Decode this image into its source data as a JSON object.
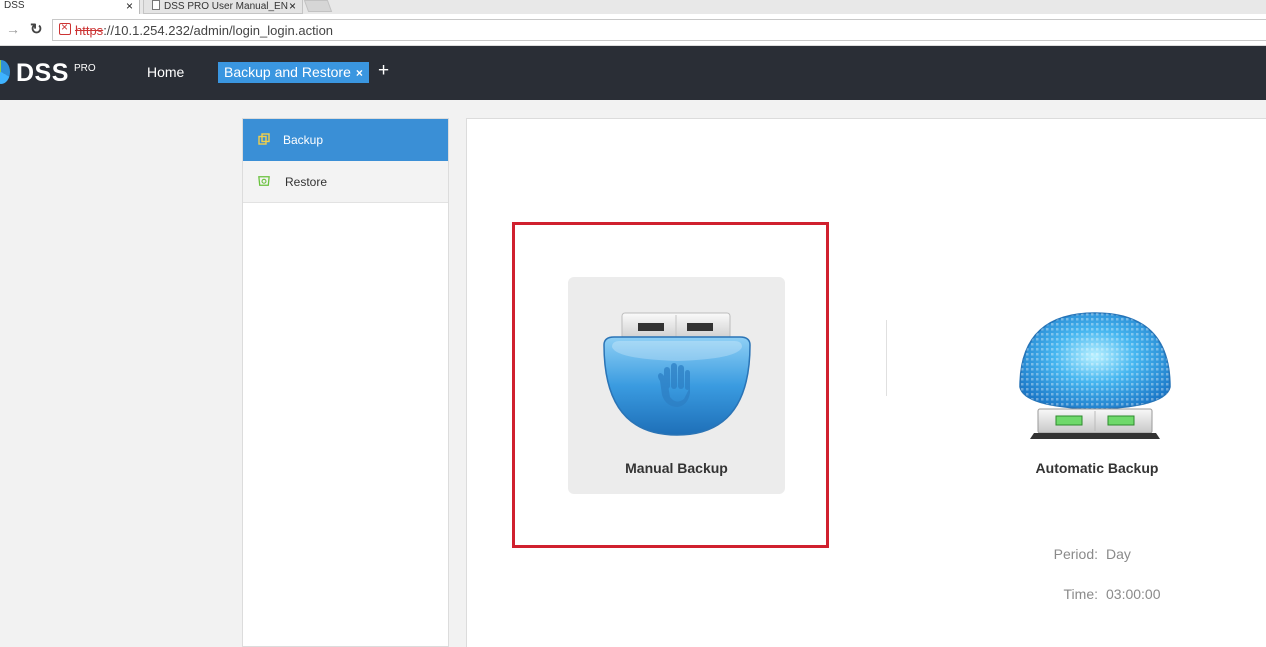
{
  "browser": {
    "tabs": [
      {
        "title": "DSS",
        "close": "×"
      },
      {
        "title": "DSS PRO User Manual_EN",
        "close": "×"
      }
    ],
    "url_protocol": "https",
    "url_rest": "://10.1.254.232/admin/login_login.action"
  },
  "header": {
    "logo": "DSS",
    "logo_sup": "PRO",
    "home_label": "Home",
    "active_tab": "Backup and Restore",
    "active_tab_close": "×",
    "add_tab": "+"
  },
  "menu": {
    "items": [
      {
        "label": "Backup",
        "icon": "copy-icon",
        "active": true
      },
      {
        "label": "Restore",
        "icon": "restore-icon",
        "active": false
      }
    ]
  },
  "main": {
    "manual_backup_label": "Manual Backup",
    "auto_backup_label": "Automatic Backup",
    "period_key": "Period:",
    "period_value": "Day",
    "time_key": "Time:",
    "time_value": "03:00:00"
  },
  "colors": {
    "header_bg": "#2a2e36",
    "accent": "#3a8fd6",
    "highlight_border": "#d0202e"
  }
}
